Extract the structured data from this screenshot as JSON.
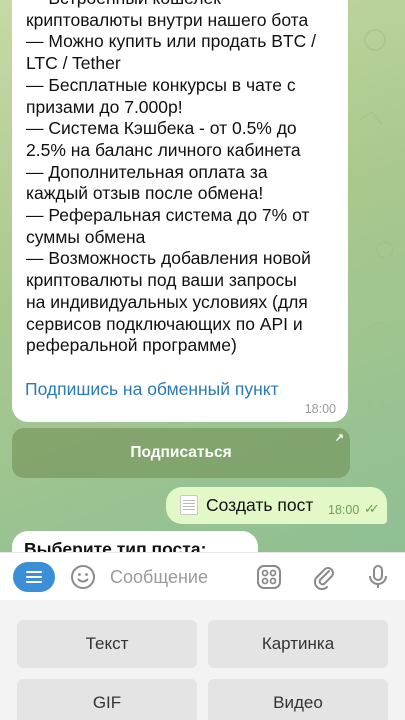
{
  "chat": {
    "incoming_message": {
      "text": "— Встроенный кошелек\nкриптовалюты внутри нашего бота\n— Можно купить или продать BTC /\nLTC / Tether\n— Бесплатные конкурсы в чате с\nпризами до 7.000р!\n— Система Кэшбека - от 0.5% до\n2.5% на баланс личного кабинета\n— Дополнительная оплата за\nкаждый отзыв после обмена!\n— Реферальная система до 7% от\nсуммы обмена\n— Возможность добавления новой\nкриптовалюты под ваши запросы\nна индивидуальных условиях (для\nсервисов подключающих по API и\nреферальной программе)",
      "link": "Подпишись на обменный пункт",
      "time": "18:00"
    },
    "inline_button": {
      "label": "Подписаться",
      "arrow": "↗"
    },
    "outgoing_message": {
      "text": "Создать пост",
      "time": "18:00",
      "status_icon": "double-check-icon"
    },
    "partial_message": {
      "text": "Выберите тип поста:"
    }
  },
  "composer": {
    "placeholder": "Сообщение",
    "icons": [
      "menu-icon",
      "emoji-icon",
      "sticker-icon",
      "attach-icon",
      "mic-icon"
    ]
  },
  "keyboard": {
    "buttons": [
      "Текст",
      "Картинка",
      "GIF",
      "Видео"
    ]
  },
  "colors": {
    "accent": "#3a8fd6",
    "link": "#2a7ab8",
    "outgoing_bubble": "#e2f8c6",
    "check": "#5ea64a"
  }
}
